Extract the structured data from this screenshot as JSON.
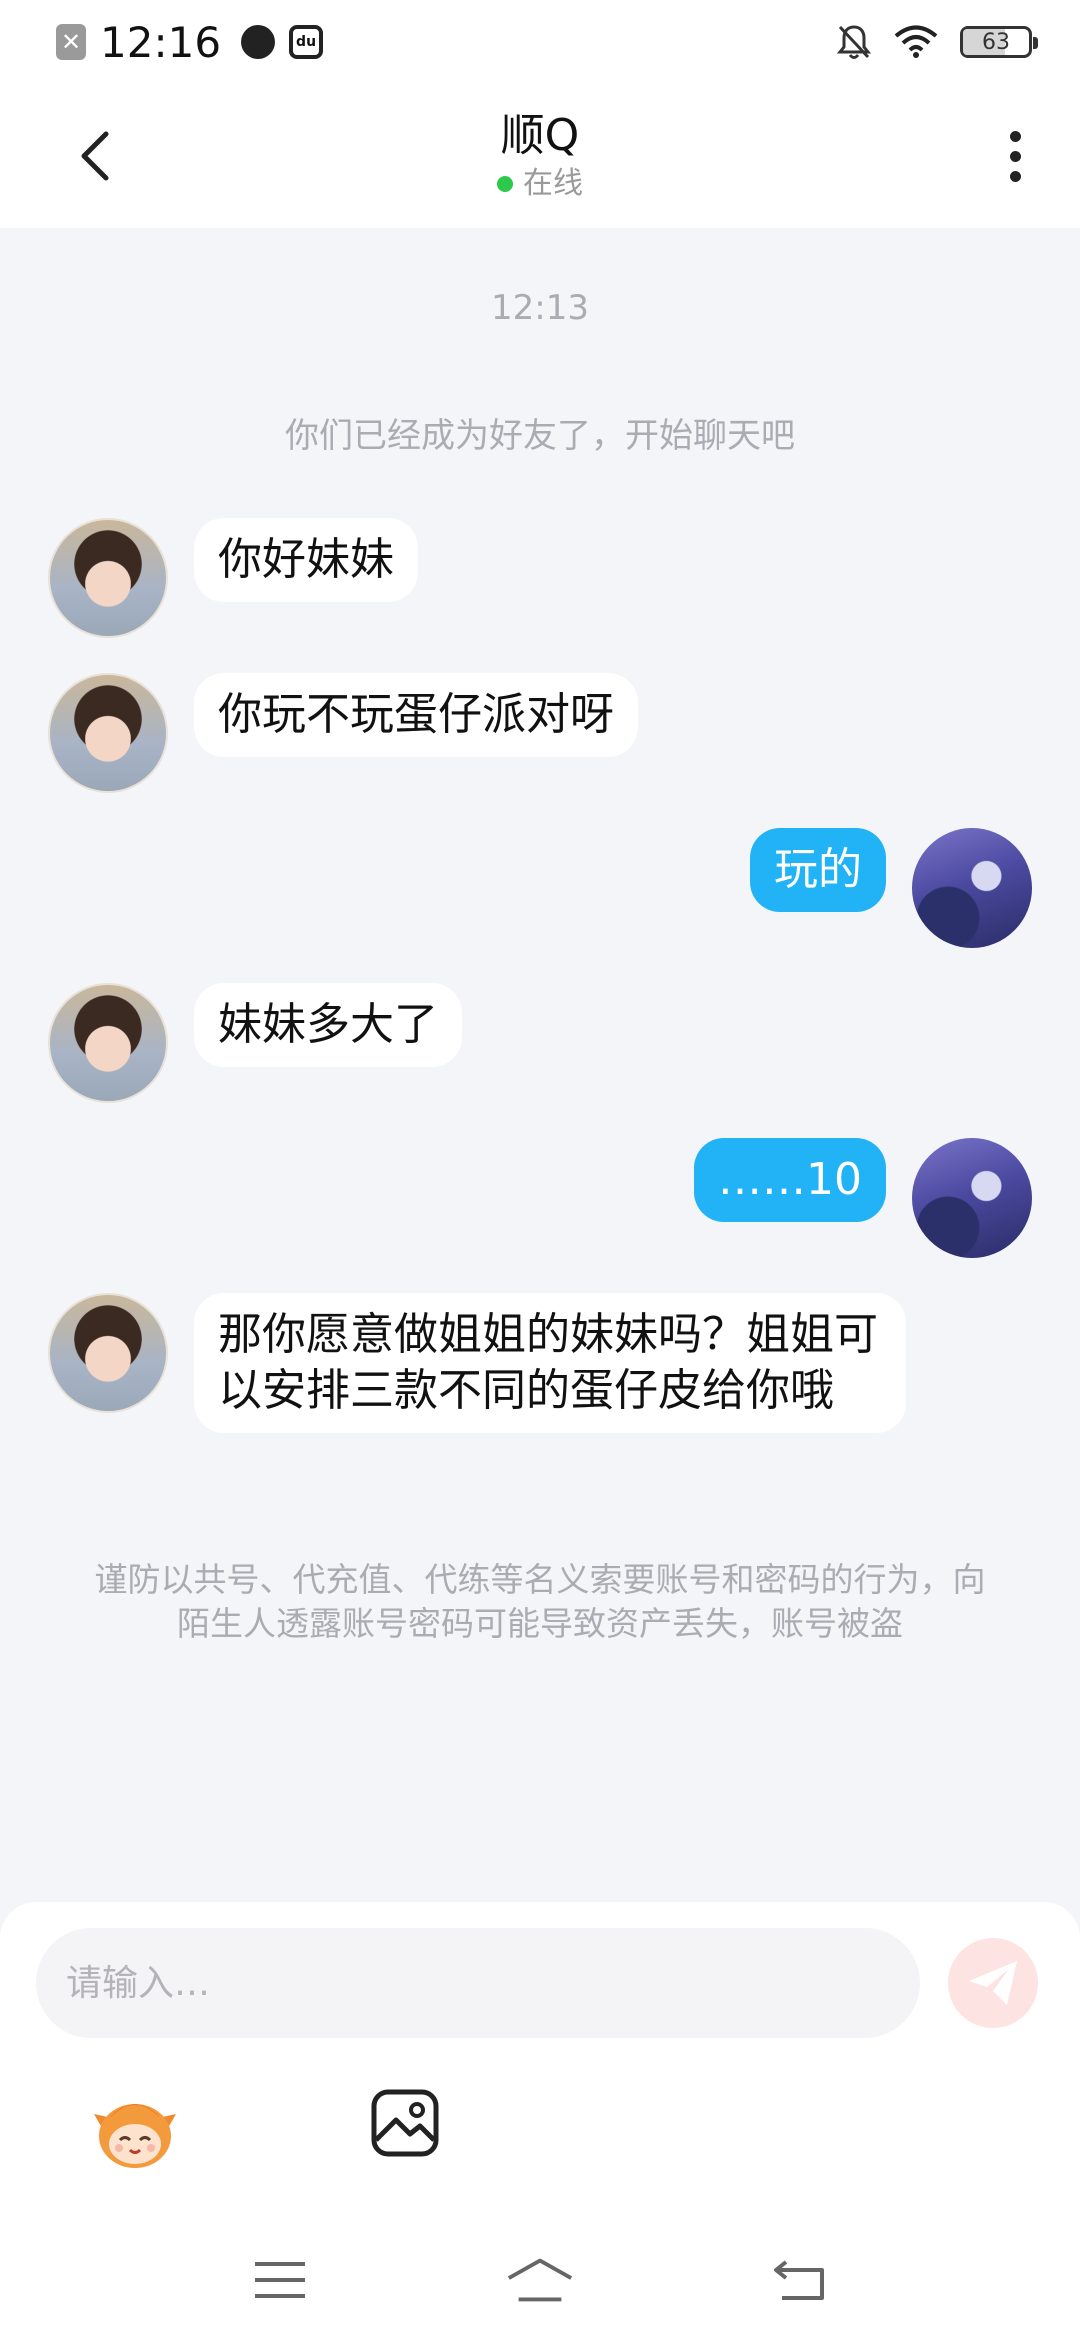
{
  "status_bar": {
    "time": "12:16",
    "battery": "63",
    "icons": [
      "close-box-icon",
      "speedometer-icon",
      "du-app-icon",
      "bell-muted-icon",
      "wifi-icon",
      "battery-icon"
    ]
  },
  "header": {
    "title": "顺Q",
    "status": "在线",
    "status_color": "#2dc94b"
  },
  "chat": {
    "timestamp": "12:13",
    "system_tip": "你们已经成为好友了，开始聊天吧",
    "messages": [
      {
        "sender": "other",
        "text": "你好妹妹"
      },
      {
        "sender": "other",
        "text": "你玩不玩蛋仔派对呀"
      },
      {
        "sender": "me",
        "text": "玩的"
      },
      {
        "sender": "other",
        "text": "妹妹多大了"
      },
      {
        "sender": "me",
        "text": "……10"
      },
      {
        "sender": "other",
        "text": "那你愿意做姐姐的妹妹吗？姐姐可以安排三款不同的蛋仔皮给你哦"
      }
    ],
    "warning": "谨防以共号、代充值、代练等名义索要账号和密码的行为，向陌生人透露账号密码可能导致资产丢失，账号被盗"
  },
  "input": {
    "placeholder": "请输入…"
  },
  "colors": {
    "my_bubble": "#21b3f5",
    "other_bubble": "#ffffff",
    "background": "#f4f5f9",
    "send_button": "#fde3e1"
  }
}
